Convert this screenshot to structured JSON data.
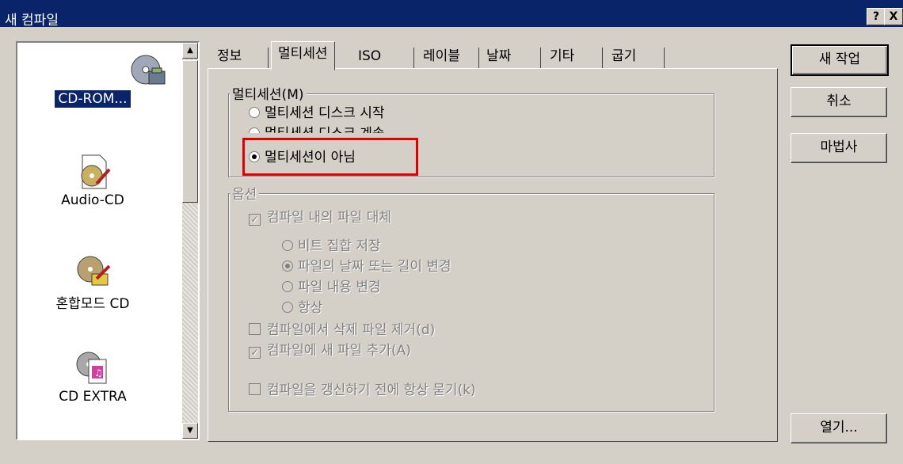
{
  "window": {
    "title": "새 컴파일",
    "help_btn": "?",
    "close_btn": "X"
  },
  "list": {
    "items": [
      {
        "label": "CD-ROM...",
        "selected": true,
        "icon": "cdrom-icon"
      },
      {
        "label": "Audio-CD",
        "selected": false,
        "icon": "audio-cd-icon"
      },
      {
        "label": "혼합모드 CD",
        "selected": false,
        "icon": "mixed-mode-cd-icon"
      },
      {
        "label": "CD EXTRA",
        "selected": false,
        "icon": "cd-extra-icon"
      }
    ]
  },
  "tabs": [
    {
      "label": "정보",
      "active": false
    },
    {
      "label": "멀티세션",
      "active": true
    },
    {
      "label": "ISO",
      "active": false
    },
    {
      "label": "레이블",
      "active": false
    },
    {
      "label": "날짜",
      "active": false
    },
    {
      "label": "기타",
      "active": false
    },
    {
      "label": "굽기",
      "active": false
    }
  ],
  "multisession": {
    "title": "멀티세션(M)",
    "options": [
      {
        "label": "멀티세션 디스크 시작",
        "checked": false
      },
      {
        "label": "멀티세션 디스크 계속",
        "checked": false
      },
      {
        "label": "멀티세션이 아님",
        "checked": true
      }
    ]
  },
  "options": {
    "title": "옵션",
    "replace_files": "컴파일 내의 파일 대체",
    "sub_options": [
      {
        "label": "비트 집합 저장",
        "checked": false
      },
      {
        "label": "파일의 날짜 또는 길이 변경",
        "checked": true
      },
      {
        "label": "파일 내용 변경",
        "checked": false
      },
      {
        "label": "항상",
        "checked": false
      }
    ],
    "remove_deleted": "컴파일에서 삭제 파일 제거(d)",
    "add_new": "컴파일에 새 파일 추가(A)",
    "ask_before_refresh": "컴파일을 갱신하기 전에 항상 묻기(k)"
  },
  "buttons": {
    "new_job": "새 작업",
    "cancel": "취소",
    "wizard": "마법사",
    "open": "열기..."
  }
}
